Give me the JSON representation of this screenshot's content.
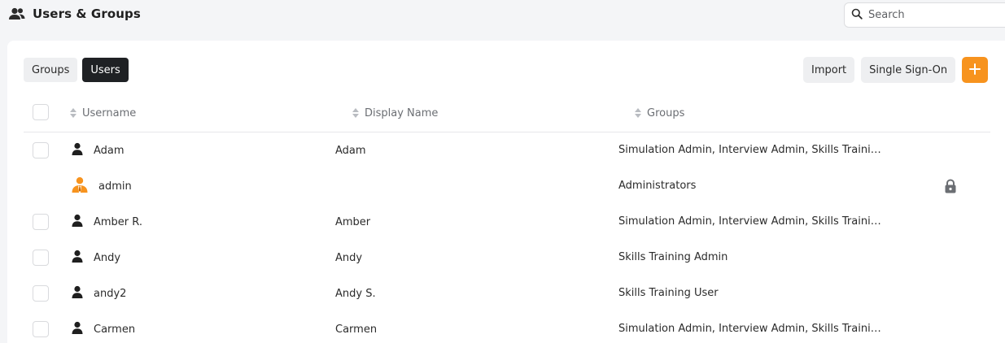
{
  "header": {
    "title": "Users & Groups",
    "title_icon": "users-icon"
  },
  "search": {
    "placeholder": "Search",
    "icon": "search-icon"
  },
  "tabs": [
    {
      "label": "Groups",
      "active": false
    },
    {
      "label": "Users",
      "active": true
    }
  ],
  "actions": {
    "import_label": "Import",
    "sso_label": "Single Sign-On",
    "add_icon": "plus-icon",
    "accent_color": "#f7931e"
  },
  "table": {
    "columns": [
      "Username",
      "Display Name",
      "Groups"
    ],
    "rows": [
      {
        "username": "Adam",
        "display_name": "Adam",
        "groups": "Simulation Admin, Interview Admin, Skills Training Admin",
        "icon": "user-icon",
        "selectable": true,
        "locked": false
      },
      {
        "username": "admin",
        "display_name": "",
        "groups": "Administrators",
        "icon": "admin-user-icon",
        "selectable": false,
        "locked": true
      },
      {
        "username": "Amber R.",
        "display_name": "Amber",
        "groups": "Simulation Admin, Interview Admin, Skills Training Admin",
        "icon": "user-icon",
        "selectable": true,
        "locked": false
      },
      {
        "username": "Andy",
        "display_name": "Andy",
        "groups": "Skills Training Admin",
        "icon": "user-icon",
        "selectable": true,
        "locked": false
      },
      {
        "username": "andy2",
        "display_name": "Andy S.",
        "groups": "Skills Training User",
        "icon": "user-icon",
        "selectable": true,
        "locked": false
      },
      {
        "username": "Carmen",
        "display_name": "Carmen",
        "groups": "Simulation Admin, Interview Admin, Skills Training Admin",
        "icon": "user-icon",
        "selectable": true,
        "locked": false
      }
    ]
  }
}
